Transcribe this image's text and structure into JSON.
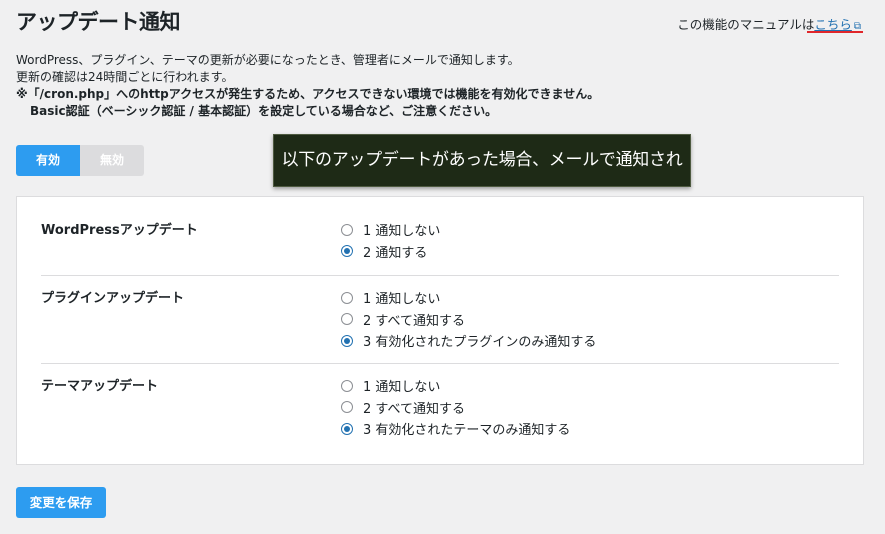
{
  "header": {
    "title": "アップデート通知",
    "manual_prefix": "この機能のマニュアルは",
    "manual_link": "こちら",
    "manual_link_icon": "external-link-icon"
  },
  "description": {
    "line1": "WordPress、プラグイン、テーマの更新が必要になったとき、管理者にメールで通知します。",
    "line2": "更新の確認は24時間ごとに行われます。",
    "warning1": "※「/cron.php」へのhttpアクセスが発生するため、アクセスできない環境では機能を有効化できません。",
    "warning2": "Basic認証（ベーシック認証 / 基本認証）を設定している場合など、ご注意ください。"
  },
  "toggle": {
    "on_label": "有効",
    "off_label": "無効",
    "selected": "on"
  },
  "callout": {
    "text": "以下のアップデートがあった場合、メールで通知される。"
  },
  "sections": [
    {
      "label": "WordPressアップデート",
      "options": [
        {
          "label": "1 通知しない",
          "checked": false
        },
        {
          "label": "2 通知する",
          "checked": true
        }
      ]
    },
    {
      "label": "プラグインアップデート",
      "options": [
        {
          "label": "1 通知しない",
          "checked": false
        },
        {
          "label": "2 すべて通知する",
          "checked": false
        },
        {
          "label": "3 有効化されたプラグインのみ通知する",
          "checked": true
        }
      ]
    },
    {
      "label": "テーマアップデート",
      "options": [
        {
          "label": "1 通知しない",
          "checked": false
        },
        {
          "label": "2 すべて通知する",
          "checked": false
        },
        {
          "label": "3 有効化されたテーマのみ通知する",
          "checked": true
        }
      ]
    }
  ],
  "save_label": "変更を保存",
  "colors": {
    "accent": "#2d9cf0",
    "radio": "#2271b1",
    "underline": "#e0262b",
    "callout_bg": "#1e2a16"
  }
}
